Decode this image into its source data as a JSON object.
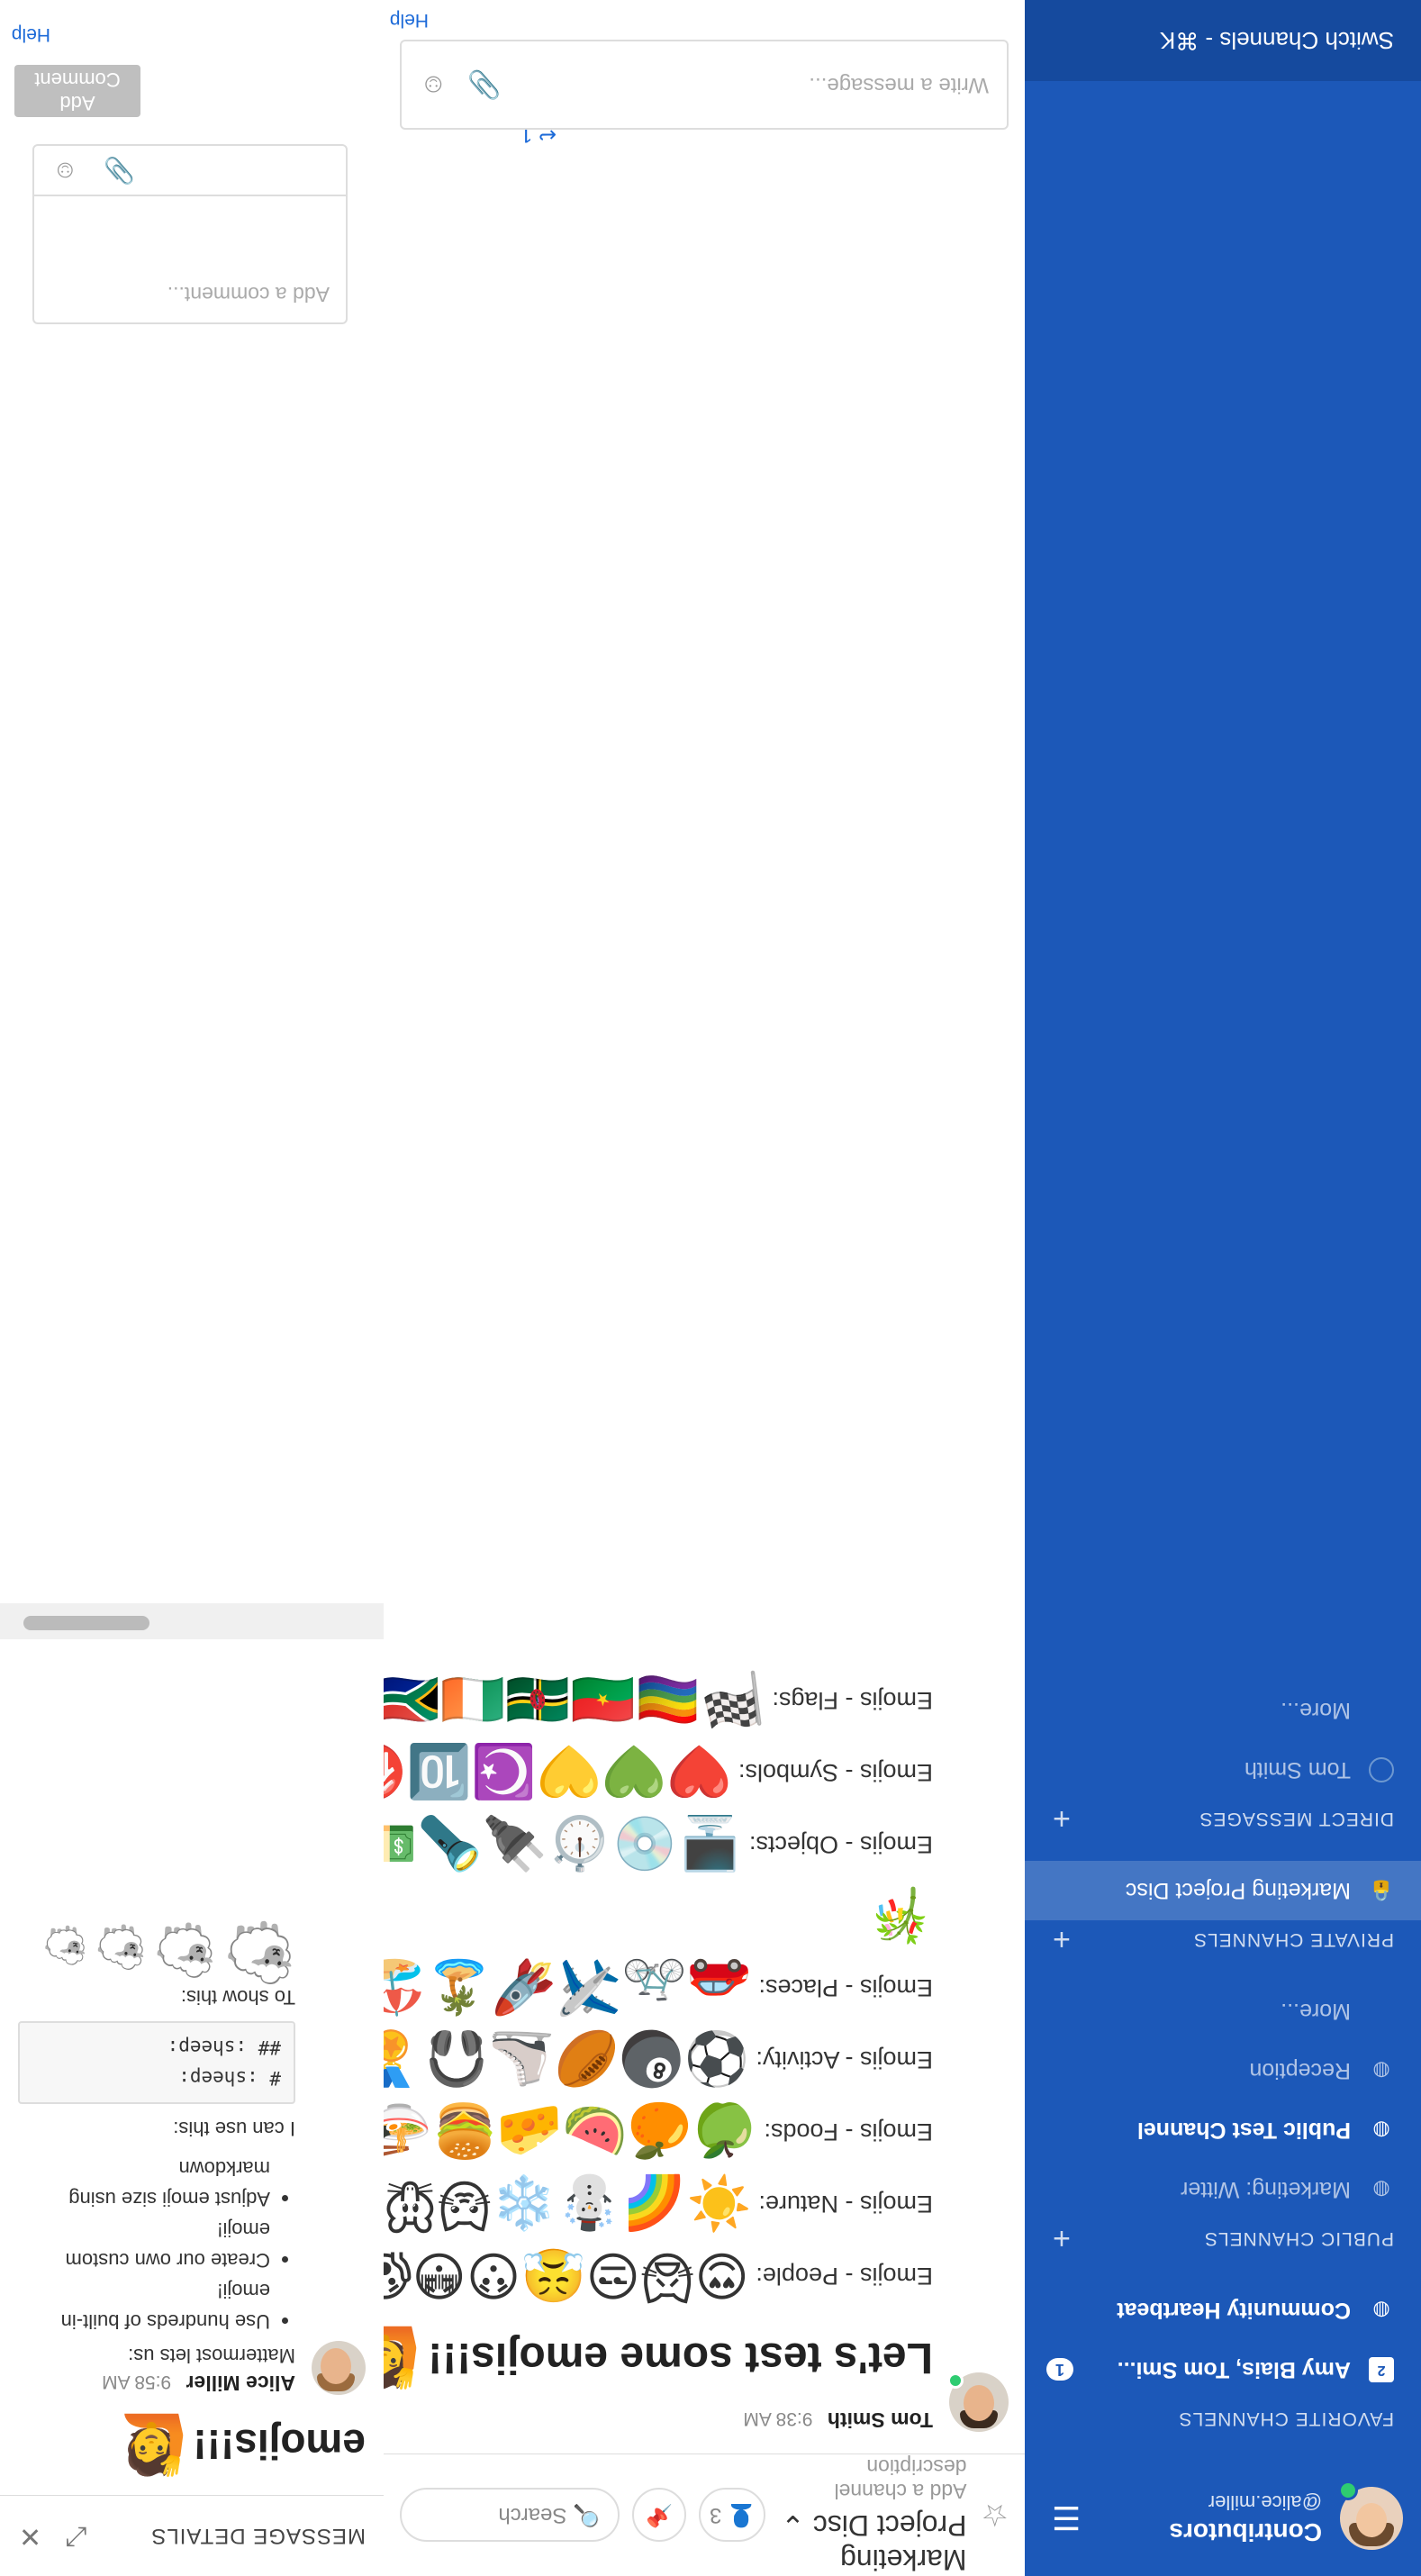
{
  "sidebar": {
    "team_name": "Contributors",
    "username": "@alice.miller",
    "sections": {
      "favorites": {
        "title": "FAVORITE CHANNELS",
        "items": [
          {
            "label": "Amy Blais, Tom Smi...",
            "badge": "1"
          },
          {
            "label": "Community Heartbeat"
          }
        ]
      },
      "public": {
        "title": "PUBLIC CHANNELS",
        "items": [
          {
            "label": "Marketing: Witter"
          },
          {
            "label": "Public Test Channel"
          },
          {
            "label": "Reception"
          },
          {
            "label": "More..."
          }
        ]
      },
      "private": {
        "title": "PRIVATE CHANNELS",
        "items": [
          {
            "label": "Marketing Project Disc"
          }
        ]
      },
      "direct": {
        "title": "DIRECT MESSAGES",
        "items": [
          {
            "label": "Tom Smith"
          },
          {
            "label": "More..."
          }
        ]
      }
    },
    "switch_label": "Switch Channels - ⌘K"
  },
  "channel": {
    "name": "Marketing Project Disc",
    "description": "Add a channel description",
    "search_placeholder": "Search",
    "member_count": "3"
  },
  "message": {
    "author": "Tom Smith",
    "time": "9:38 AM",
    "headline": "Let's test some emojis!!!",
    "rows": [
      {
        "label": "Emojis - People:",
        "emoji": "😍🙀😒😤😯😳😱😭😁😆😓😅🤣😂🙄☺️😊😇😄😗😐😉"
      },
      {
        "label": "Emojis - Nature:",
        "emoji": "☀️🌈☃️❄️🐱🐭🐷🐤🐔🌿🌵🌻🌺🌕🌙⭐"
      },
      {
        "label": "Emojis - Foods:",
        "emoji": "🍏🍊🍉🧀🍔🍜🍿🥗🍕🍩🍷🥐"
      },
      {
        "label": "Emojis - Activity:",
        "emoji": "⚽🎱🏉⛸️🎧🏅🎸🎮🎲🎬🎨🎭🎪"
      },
      {
        "label": "Emojis - Places:",
        "emoji": "🚗🚲✈️🚀🏝️🏖️⛺🏰🏠🏥🌅🚲🗽"
      },
      {
        "label": "Emojis - Objects:",
        "emoji": "🖥️💿⏱️🔌🔦💵⛏️🔑🚪🎉📅📪🧽"
      },
      {
        "label": "Emojis - Symbols:",
        "emoji": "❤️💚💛☪️🔟🉐❗♻️✅🅿️🎵🕐"
      },
      {
        "label": "Emojis - Flags:",
        "emoji": "🏁🏳️‍🌈🇧🇫🇩🇲🇮🇪🇿🇦🇦🇺🇺🇸🇦🇷🇲🇽🇳🇱"
      }
    ],
    "extra_emoji": "🎋",
    "reply_count": "1"
  },
  "composer": {
    "placeholder": "Write a message...",
    "help": "Help"
  },
  "rhs": {
    "header": "MESSAGE DETAILS",
    "root_title": "emojis!!!",
    "reply_author": "Alice Miller",
    "reply_time": "9:58 AM",
    "reply_intro": "Mattermost lets us:",
    "bullets": [
      "Use hundreds of built-in emoji!",
      "Create our own custom emoji!",
      "Adjust emoji size using markdown"
    ],
    "can_use": "I can use this:",
    "code_lines": [
      "# :sheep:",
      "## :sheep:"
    ],
    "to_show": "To show this:",
    "comment_placeholder": "Add a comment...",
    "add_comment": "Add Comment",
    "help": "Help"
  }
}
